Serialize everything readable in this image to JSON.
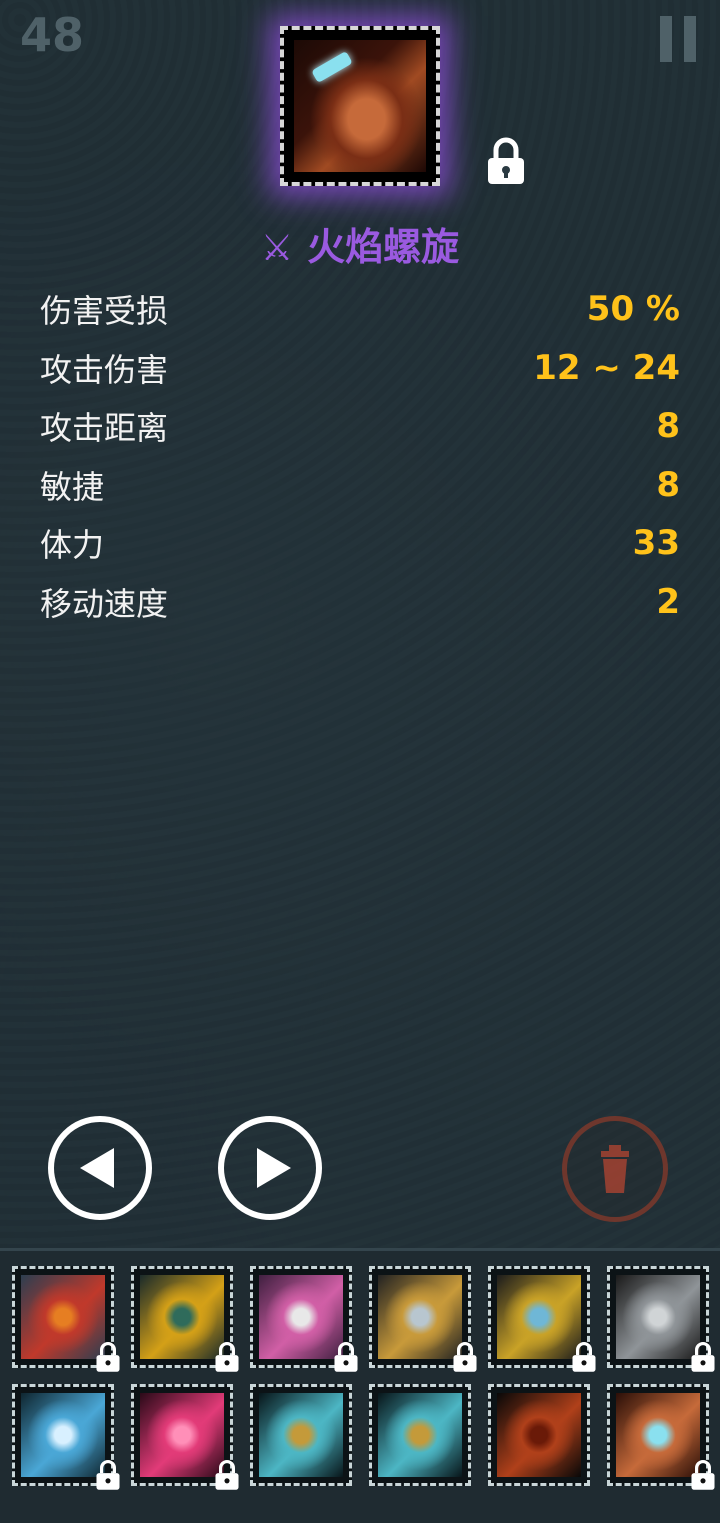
{
  "hud": {
    "level": "48"
  },
  "item": {
    "name": "火焰螺旋",
    "icon": "crossed-swords-icon",
    "locked": true,
    "glow_color": "#9a5ae0"
  },
  "stats": [
    {
      "label": "伤害受损",
      "value": "50 %"
    },
    {
      "label": "攻击伤害",
      "value": "12 ~ 24"
    },
    {
      "label": "攻击距离",
      "value": "8"
    },
    {
      "label": "敏捷",
      "value": "8"
    },
    {
      "label": "体力",
      "value": "33"
    },
    {
      "label": "移动速度",
      "value": "2"
    }
  ],
  "colors": {
    "value": "#ffc21a",
    "label": "#f2f2f2",
    "title": "#9a5ae0"
  },
  "inventory": [
    {
      "name": "spiked-armor",
      "locked": true
    },
    {
      "name": "golden-helm-armor",
      "locked": true
    },
    {
      "name": "pink-dagger",
      "locked": true
    },
    {
      "name": "blade-gauntlet",
      "locked": true
    },
    {
      "name": "gold-claw",
      "locked": true
    },
    {
      "name": "spiked-mace",
      "locked": true
    },
    {
      "name": "blue-ring",
      "locked": true
    },
    {
      "name": "heart-pendant",
      "locked": true
    },
    {
      "name": "cyan-chest-armor",
      "locked": false
    },
    {
      "name": "cyan-chest-armor-2",
      "locked": false
    },
    {
      "name": "bomb-potion",
      "locked": false
    },
    {
      "name": "flame-spiral",
      "locked": true
    }
  ]
}
